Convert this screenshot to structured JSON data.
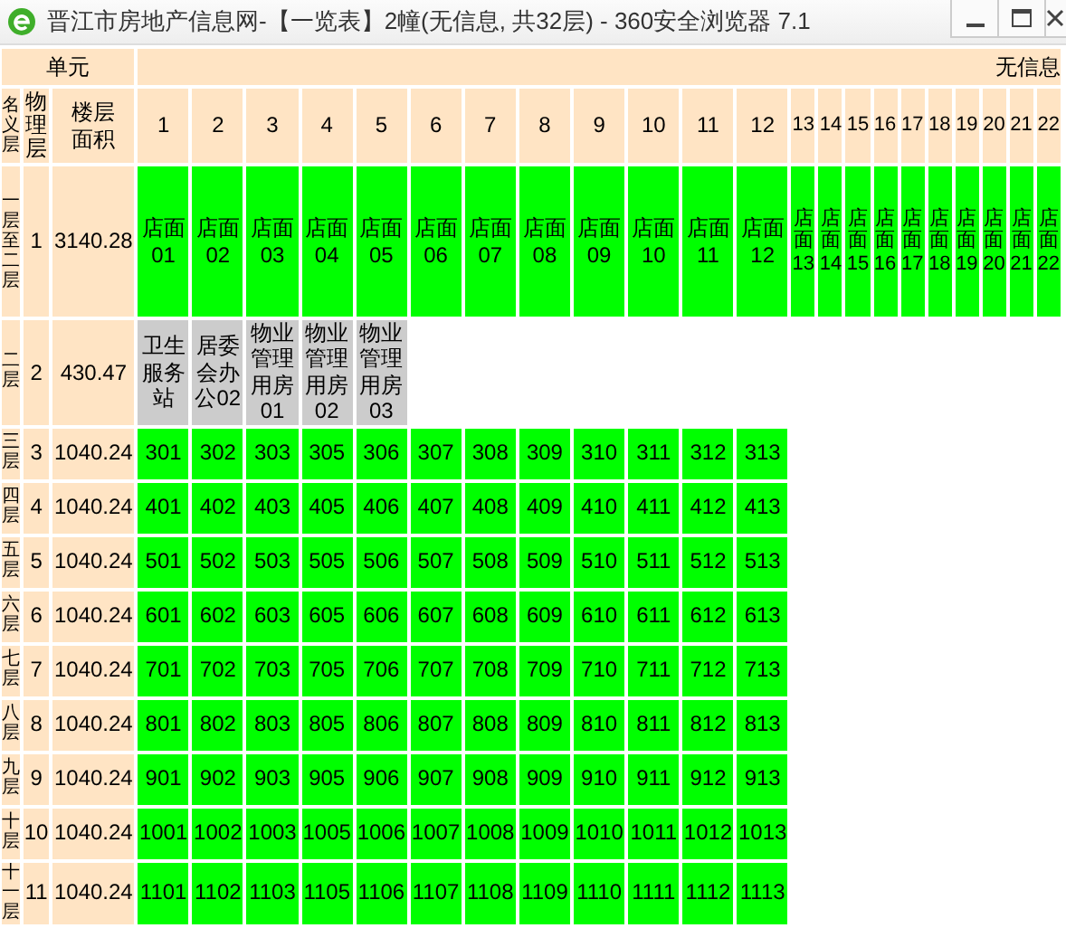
{
  "window": {
    "title": "晋江市房地产信息网-【一览表】2幢(无信息, 共32层) - 360安全浏览器 7.1"
  },
  "table": {
    "unit_header": "单元",
    "building_header": "无信息",
    "columns": {
      "nominal_floor": "名义层",
      "physical_floor": "物理层",
      "floor_area": "楼层面积"
    },
    "unit_columns": [
      "1",
      "2",
      "3",
      "4",
      "5",
      "6",
      "7",
      "8",
      "9",
      "10",
      "11",
      "12",
      "13",
      "14",
      "15",
      "16",
      "17",
      "18",
      "19",
      "20",
      "21",
      "22"
    ],
    "floors": [
      {
        "nominal": "一层至二层",
        "physical": "1",
        "area": "3140.28",
        "units": [
          {
            "label": "店面01",
            "color": "#00ff00"
          },
          {
            "label": "店面02",
            "color": "#00ff00"
          },
          {
            "label": "店面03",
            "color": "#00ff00"
          },
          {
            "label": "店面04",
            "color": "#00ff00"
          },
          {
            "label": "店面05",
            "color": "#00ff00"
          },
          {
            "label": "店面06",
            "color": "#00ff00"
          },
          {
            "label": "店面07",
            "color": "#00ff00"
          },
          {
            "label": "店面08",
            "color": "#00ff00"
          },
          {
            "label": "店面09",
            "color": "#00ff00"
          },
          {
            "label": "店面10",
            "color": "#00ff00"
          },
          {
            "label": "店面11",
            "color": "#00ff00"
          },
          {
            "label": "店面12",
            "color": "#00ff00"
          },
          {
            "label": "店面13",
            "color": "#00ff00"
          },
          {
            "label": "店面14",
            "color": "#00ff00"
          },
          {
            "label": "店面15",
            "color": "#00ff00"
          },
          {
            "label": "店面16",
            "color": "#00ff00"
          },
          {
            "label": "店面17",
            "color": "#00ff00"
          },
          {
            "label": "店面18",
            "color": "#00ff00"
          },
          {
            "label": "店面19",
            "color": "#00ff00"
          },
          {
            "label": "店面20",
            "color": "#00ff00"
          },
          {
            "label": "店面21",
            "color": "#00ff00"
          },
          {
            "label": "店面22",
            "color": "#00ff00"
          }
        ]
      },
      {
        "nominal": "二层",
        "physical": "2",
        "area": "430.47",
        "units": [
          {
            "label": "卫生服务站",
            "color": "#cccccc"
          },
          {
            "label": "居委会办公02",
            "color": "#cccccc"
          },
          {
            "label": "物业管理用房01",
            "color": "#cccccc"
          },
          {
            "label": "物业管理用房02",
            "color": "#cccccc"
          },
          {
            "label": "物业管理用房03",
            "color": "#cccccc"
          }
        ]
      },
      {
        "nominal": "三层",
        "physical": "3",
        "area": "1040.24",
        "units": [
          {
            "label": "301",
            "color": "#00ff00"
          },
          {
            "label": "302",
            "color": "#00ff00"
          },
          {
            "label": "303",
            "color": "#00ff00"
          },
          {
            "label": "305",
            "color": "#00ff00"
          },
          {
            "label": "306",
            "color": "#00ff00"
          },
          {
            "label": "307",
            "color": "#00ff00"
          },
          {
            "label": "308",
            "color": "#00ff00"
          },
          {
            "label": "309",
            "color": "#00ff00"
          },
          {
            "label": "310",
            "color": "#00ff00"
          },
          {
            "label": "311",
            "color": "#00ff00"
          },
          {
            "label": "312",
            "color": "#00ff00"
          },
          {
            "label": "313",
            "color": "#00ff00"
          }
        ]
      },
      {
        "nominal": "四层",
        "physical": "4",
        "area": "1040.24",
        "units": [
          {
            "label": "401",
            "color": "#00ff00"
          },
          {
            "label": "402",
            "color": "#00ff00"
          },
          {
            "label": "403",
            "color": "#00ff00"
          },
          {
            "label": "405",
            "color": "#00ff00"
          },
          {
            "label": "406",
            "color": "#00ff00"
          },
          {
            "label": "407",
            "color": "#00ff00"
          },
          {
            "label": "408",
            "color": "#00ff00"
          },
          {
            "label": "409",
            "color": "#00ff00"
          },
          {
            "label": "410",
            "color": "#00ff00"
          },
          {
            "label": "411",
            "color": "#00ff00"
          },
          {
            "label": "412",
            "color": "#00ff00"
          },
          {
            "label": "413",
            "color": "#00ff00"
          }
        ]
      },
      {
        "nominal": "五层",
        "physical": "5",
        "area": "1040.24",
        "units": [
          {
            "label": "501",
            "color": "#00ff00"
          },
          {
            "label": "502",
            "color": "#00ff00"
          },
          {
            "label": "503",
            "color": "#00ff00"
          },
          {
            "label": "505",
            "color": "#00ff00"
          },
          {
            "label": "506",
            "color": "#00ff00"
          },
          {
            "label": "507",
            "color": "#00ff00"
          },
          {
            "label": "508",
            "color": "#00ff00"
          },
          {
            "label": "509",
            "color": "#00ff00"
          },
          {
            "label": "510",
            "color": "#00ff00"
          },
          {
            "label": "511",
            "color": "#00ff00"
          },
          {
            "label": "512",
            "color": "#00ff00"
          },
          {
            "label": "513",
            "color": "#00ff00"
          }
        ]
      },
      {
        "nominal": "六层",
        "physical": "6",
        "area": "1040.24",
        "units": [
          {
            "label": "601",
            "color": "#00ff00"
          },
          {
            "label": "602",
            "color": "#00ff00"
          },
          {
            "label": "603",
            "color": "#00ff00"
          },
          {
            "label": "605",
            "color": "#00ff00"
          },
          {
            "label": "606",
            "color": "#00ff00"
          },
          {
            "label": "607",
            "color": "#00ff00"
          },
          {
            "label": "608",
            "color": "#00ff00"
          },
          {
            "label": "609",
            "color": "#00ff00"
          },
          {
            "label": "610",
            "color": "#00ff00"
          },
          {
            "label": "611",
            "color": "#00ff00"
          },
          {
            "label": "612",
            "color": "#00ff00"
          },
          {
            "label": "613",
            "color": "#00ff00"
          }
        ]
      },
      {
        "nominal": "七层",
        "physical": "7",
        "area": "1040.24",
        "units": [
          {
            "label": "701",
            "color": "#00ff00"
          },
          {
            "label": "702",
            "color": "#00ff00"
          },
          {
            "label": "703",
            "color": "#00ff00"
          },
          {
            "label": "705",
            "color": "#00ff00"
          },
          {
            "label": "706",
            "color": "#00ff00"
          },
          {
            "label": "707",
            "color": "#00ff00"
          },
          {
            "label": "708",
            "color": "#00ff00"
          },
          {
            "label": "709",
            "color": "#00ff00"
          },
          {
            "label": "710",
            "color": "#00ff00"
          },
          {
            "label": "711",
            "color": "#00ff00"
          },
          {
            "label": "712",
            "color": "#00ff00"
          },
          {
            "label": "713",
            "color": "#00ff00"
          }
        ]
      },
      {
        "nominal": "八层",
        "physical": "8",
        "area": "1040.24",
        "units": [
          {
            "label": "801",
            "color": "#00ff00"
          },
          {
            "label": "802",
            "color": "#00ff00"
          },
          {
            "label": "803",
            "color": "#00ff00"
          },
          {
            "label": "805",
            "color": "#00ff00"
          },
          {
            "label": "806",
            "color": "#00ff00"
          },
          {
            "label": "807",
            "color": "#00ff00"
          },
          {
            "label": "808",
            "color": "#00ff00"
          },
          {
            "label": "809",
            "color": "#00ff00"
          },
          {
            "label": "810",
            "color": "#00ff00"
          },
          {
            "label": "811",
            "color": "#00ff00"
          },
          {
            "label": "812",
            "color": "#00ff00"
          },
          {
            "label": "813",
            "color": "#00ff00"
          }
        ]
      },
      {
        "nominal": "九层",
        "physical": "9",
        "area": "1040.24",
        "units": [
          {
            "label": "901",
            "color": "#00ff00"
          },
          {
            "label": "902",
            "color": "#00ff00"
          },
          {
            "label": "903",
            "color": "#00ff00"
          },
          {
            "label": "905",
            "color": "#00ff00"
          },
          {
            "label": "906",
            "color": "#00ff00"
          },
          {
            "label": "907",
            "color": "#00ff00"
          },
          {
            "label": "908",
            "color": "#00ff00"
          },
          {
            "label": "909",
            "color": "#00ff00"
          },
          {
            "label": "910",
            "color": "#00ff00"
          },
          {
            "label": "911",
            "color": "#00ff00"
          },
          {
            "label": "912",
            "color": "#00ff00"
          },
          {
            "label": "913",
            "color": "#00ff00"
          }
        ]
      },
      {
        "nominal": "十层",
        "physical": "10",
        "area": "1040.24",
        "units": [
          {
            "label": "1001",
            "color": "#00ff00"
          },
          {
            "label": "1002",
            "color": "#00ff00"
          },
          {
            "label": "1003",
            "color": "#00ff00"
          },
          {
            "label": "1005",
            "color": "#00ff00"
          },
          {
            "label": "1006",
            "color": "#00ff00"
          },
          {
            "label": "1007",
            "color": "#00ff00"
          },
          {
            "label": "1008",
            "color": "#00ff00"
          },
          {
            "label": "1009",
            "color": "#00ff00"
          },
          {
            "label": "1010",
            "color": "#00ff00"
          },
          {
            "label": "1011",
            "color": "#00ff00"
          },
          {
            "label": "1012",
            "color": "#00ff00"
          },
          {
            "label": "1013",
            "color": "#00ff00"
          }
        ]
      },
      {
        "nominal": "十一层",
        "physical": "11",
        "area": "1040.24",
        "units": [
          {
            "label": "1101",
            "color": "#00ff00"
          },
          {
            "label": "1102",
            "color": "#00ff00"
          },
          {
            "label": "1103",
            "color": "#00ff00"
          },
          {
            "label": "1105",
            "color": "#00ff00"
          },
          {
            "label": "1106",
            "color": "#00ff00"
          },
          {
            "label": "1107",
            "color": "#00ff00"
          },
          {
            "label": "1108",
            "color": "#00ff00"
          },
          {
            "label": "1109",
            "color": "#00ff00"
          },
          {
            "label": "1110",
            "color": "#00ff00"
          },
          {
            "label": "1111",
            "color": "#00ff00"
          },
          {
            "label": "1112",
            "color": "#00ff00"
          },
          {
            "label": "1113",
            "color": "#00ff00"
          }
        ]
      }
    ]
  }
}
